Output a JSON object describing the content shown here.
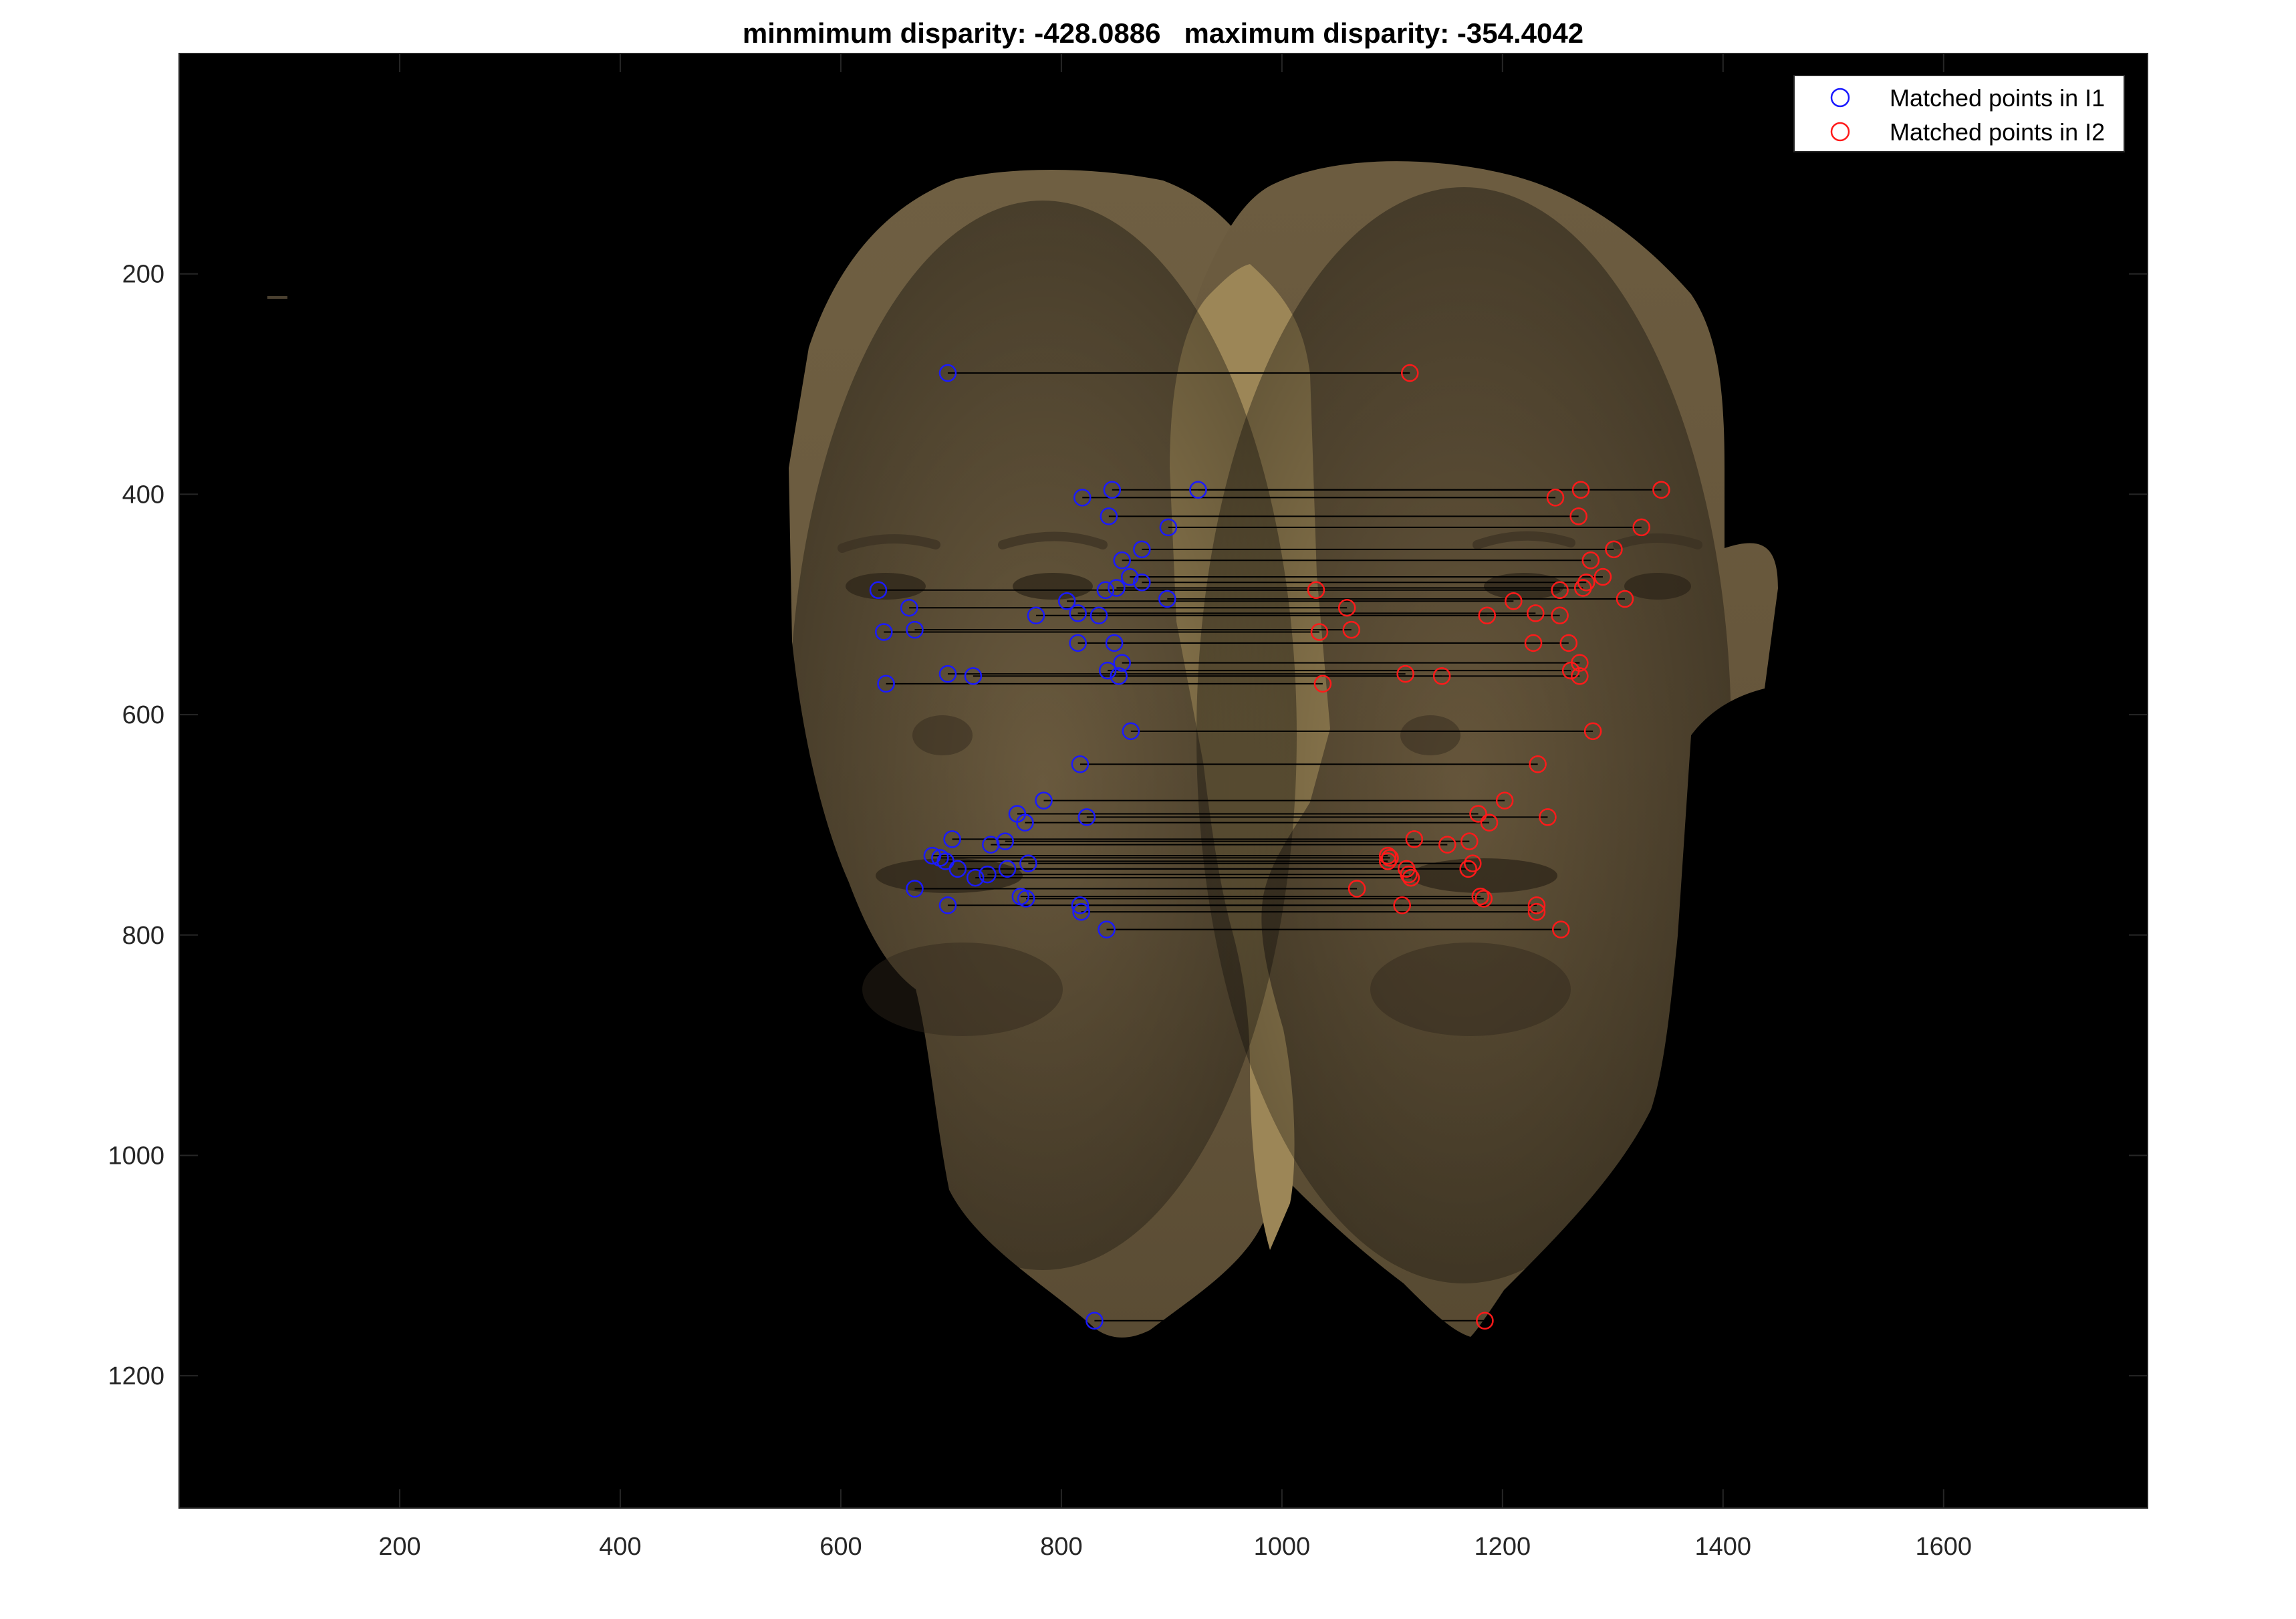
{
  "chart_data": {
    "type": "scatter",
    "title": "minmimum disparity: -428.0886   maximum disparity: -354.4042",
    "xlabel": "",
    "ylabel": "",
    "xlim": [
      0,
      1785
    ],
    "ylim": [
      0,
      1320
    ],
    "y_reversed": true,
    "x_ticks": [
      200,
      400,
      600,
      800,
      1000,
      1200,
      1400,
      1600
    ],
    "x_tick_labels": [
      "200",
      "400",
      "600",
      "800",
      "1000",
      "1200",
      "1400",
      "1600"
    ],
    "y_ticks": [
      200,
      400,
      600,
      800,
      1000,
      1200
    ],
    "y_tick_labels": [
      "200",
      "400",
      "600",
      "800",
      "1000",
      "1200"
    ],
    "grid": false,
    "legend_position": "top-right",
    "background_image": "stereo face pair (two bald male faces) on black background",
    "colors": {
      "axes_background": "#000000",
      "matches_I1": "#1a1aff",
      "matches_I2": "#ff1a1a",
      "match_lines": "#000000",
      "skin": "#7a6848"
    },
    "series": [
      {
        "name": "Matched points in I1",
        "marker": "circle",
        "color": "#1a1aff",
        "x": [
          697,
          819,
          846,
          924,
          843,
          897,
          873,
          855,
          862,
          873,
          634,
          662,
          777,
          805,
          815,
          834,
          840,
          850,
          896,
          639,
          667,
          815,
          848,
          855,
          697,
          720,
          842,
          852,
          641,
          863,
          817,
          784,
          760,
          823,
          767,
          701,
          736,
          749,
          690,
          683,
          706,
          751,
          733,
          722,
          695,
          770,
          667,
          768,
          697,
          763,
          817,
          818,
          841,
          830
        ],
        "y": [
          290,
          403,
          396,
          396,
          420,
          430,
          450,
          460,
          475,
          480,
          487,
          503,
          510,
          497,
          508,
          510,
          487,
          485,
          495,
          525,
          523,
          535,
          535,
          553,
          563,
          565,
          560,
          565,
          572,
          615,
          645,
          678,
          690,
          693,
          698,
          713,
          718,
          715,
          730,
          728,
          740,
          740,
          745,
          748,
          733,
          735,
          758,
          767,
          773,
          765,
          773,
          779,
          795,
          1150
        ]
      },
      {
        "name": "Matched points in I2",
        "marker": "circle",
        "color": "#ff1a1a",
        "x": [
          1116,
          1248,
          1271,
          1344,
          1269,
          1326,
          1301,
          1280,
          1291,
          1276,
          1031,
          1059,
          1186,
          1210,
          1230,
          1252,
          1252,
          1273,
          1311,
          1034,
          1063,
          1228,
          1260,
          1270,
          1112,
          1145,
          1262,
          1270,
          1037,
          1282,
          1232,
          1202,
          1178,
          1241,
          1188,
          1120,
          1150,
          1170,
          1098,
          1096,
          1113,
          1169,
          1115,
          1117,
          1096,
          1173,
          1068,
          1183,
          1109,
          1180,
          1231,
          1231,
          1253,
          1184
        ],
        "y": [
          290,
          403,
          396,
          396,
          420,
          430,
          450,
          460,
          475,
          480,
          487,
          503,
          510,
          497,
          508,
          510,
          487,
          485,
          495,
          525,
          523,
          535,
          535,
          553,
          563,
          565,
          560,
          565,
          572,
          615,
          645,
          678,
          690,
          693,
          698,
          713,
          718,
          715,
          730,
          728,
          740,
          740,
          745,
          748,
          733,
          735,
          758,
          767,
          773,
          765,
          773,
          779,
          795,
          1150
        ]
      }
    ]
  }
}
